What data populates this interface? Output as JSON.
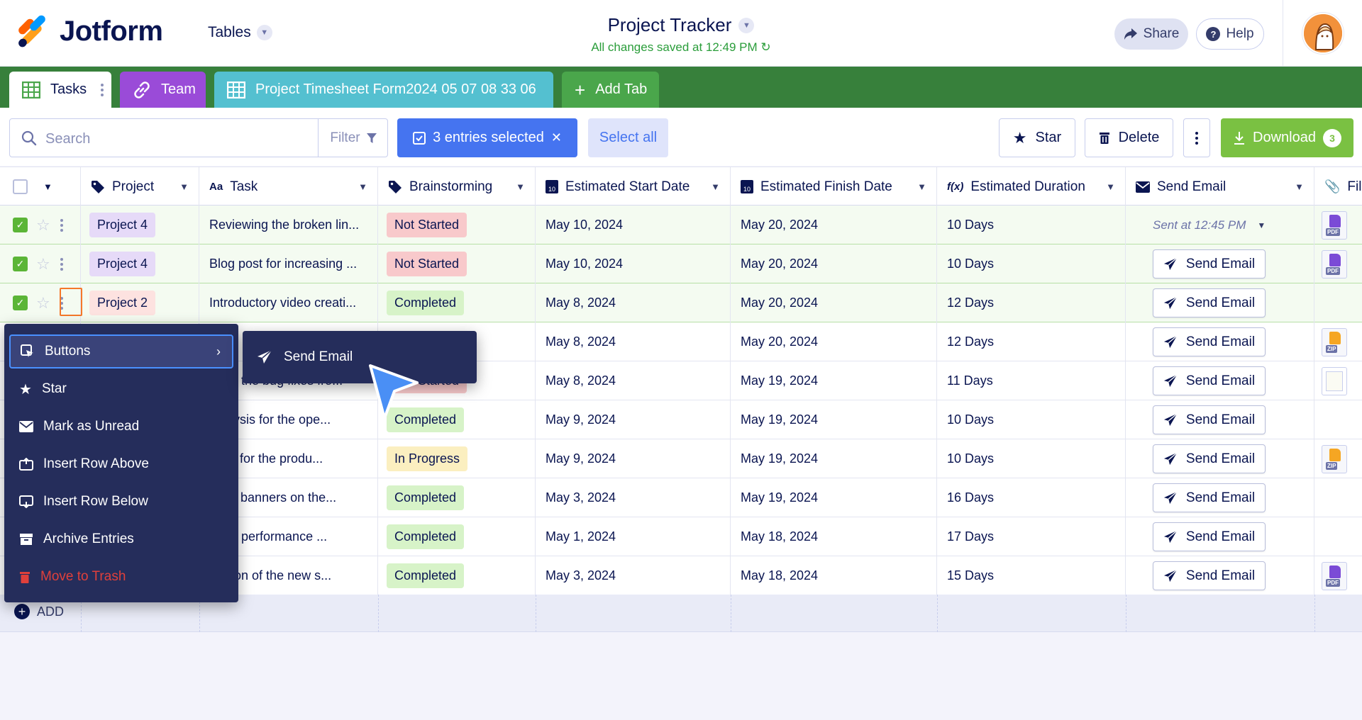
{
  "app": {
    "logo_text": "Jotform",
    "tables_label": "Tables"
  },
  "header": {
    "title": "Project Tracker",
    "saved_status": "All changes saved at 12:49 PM",
    "share_label": "Share",
    "help_label": "Help"
  },
  "tabs": [
    {
      "label": "Tasks"
    },
    {
      "label": "Team"
    },
    {
      "label": "Project Timesheet Form2024 05 07 08 33 06"
    },
    {
      "label": "Add Tab"
    }
  ],
  "toolbar": {
    "search_placeholder": "Search",
    "filter_label": "Filter",
    "selected_label": "3 entries selected",
    "select_all_label": "Select all",
    "star_label": "Star",
    "delete_label": "Delete",
    "download_label": "Download",
    "download_count": "3"
  },
  "columns": [
    "Project",
    "Task",
    "Brainstorming",
    "Estimated Start Date",
    "Estimated Finish Date",
    "Estimated Duration",
    "Send Email",
    "Fil"
  ],
  "column_icons": {
    "task_prefix": "Aa",
    "duration_prefix": "f(x)",
    "calendar_day": "10"
  },
  "rows": [
    {
      "selected": true,
      "project": "Project 4",
      "project_color": "#e6daf8",
      "task": "Reviewing the broken lin...",
      "status": "Not Started",
      "status_key": "Not",
      "start": "May 10, 2024",
      "finish": "May 20, 2024",
      "duration": "10 Days",
      "email": "sent",
      "sent_text": "Sent at 12:45 PM",
      "file": "PDF"
    },
    {
      "selected": true,
      "project": "Project 4",
      "project_color": "#e6daf8",
      "task": "Blog post for increasing ...",
      "status": "Not Started",
      "status_key": "Not",
      "start": "May 10, 2024",
      "finish": "May 20, 2024",
      "duration": "10 Days",
      "email": "button",
      "file": "PDF"
    },
    {
      "selected": true,
      "project": "Project 2",
      "project_color": "#fde2e0",
      "task": "Introductory video creati...",
      "status": "Completed",
      "status_key": "Completed",
      "start": "May 8, 2024",
      "finish": "May 20, 2024",
      "duration": "12 Days",
      "email": "button",
      "file": ""
    },
    {
      "selected": false,
      "project": "",
      "task": "",
      "status": "",
      "status_key": "",
      "start": "May 8, 2024",
      "finish": "May 20, 2024",
      "duration": "12 Days",
      "email": "button",
      "file": "ZIP"
    },
    {
      "selected": false,
      "project": "",
      "task": "aring the bug fixes fro...",
      "status": "Not Started",
      "status_key": "Not",
      "start": "May 8, 2024",
      "finish": "May 19, 2024",
      "duration": "11 Days",
      "email": "button",
      "file": "IMG"
    },
    {
      "selected": false,
      "project": "",
      "task": "analysis for the ope...",
      "status": "Completed",
      "status_key": "Completed",
      "start": "May 9, 2024",
      "finish": "May 19, 2024",
      "duration": "10 Days",
      "email": "button",
      "file": ""
    },
    {
      "selected": false,
      "project": "",
      "task": "tests for the produ...",
      "status": "In Progress",
      "status_key": "In",
      "start": "May 9, 2024",
      "finish": "May 19, 2024",
      "duration": "10 Days",
      "email": "button",
      "file": "ZIP"
    },
    {
      "selected": false,
      "project": "",
      "task": "ating banners on the...",
      "status": "Completed",
      "status_key": "Completed",
      "start": "May 3, 2024",
      "finish": "May 19, 2024",
      "duration": "16 Days",
      "email": "button",
      "file": ""
    },
    {
      "selected": false,
      "project": "",
      "task": "aring performance ...",
      "status": "Completed",
      "status_key": "Completed",
      "start": "May 1, 2024",
      "finish": "May 18, 2024",
      "duration": "17 Days",
      "email": "button",
      "file": ""
    },
    {
      "selected": false,
      "project": "",
      "task": "aration of the new s...",
      "status": "Completed",
      "status_key": "Completed",
      "start": "May 3, 2024",
      "finish": "May 18, 2024",
      "duration": "15 Days",
      "email": "button",
      "file": "PDF"
    }
  ],
  "send_email_label": "Send Email",
  "add_row_label": "ADD",
  "context_menu": {
    "items": [
      {
        "label": "Buttons",
        "icon": "cursor-box-icon"
      },
      {
        "label": "Star",
        "icon": "star-icon"
      },
      {
        "label": "Mark as Unread",
        "icon": "envelope-icon"
      },
      {
        "label": "Insert Row Above",
        "icon": "insert-above-icon"
      },
      {
        "label": "Insert Row Below",
        "icon": "insert-below-icon"
      },
      {
        "label": "Archive Entries",
        "icon": "archive-icon"
      },
      {
        "label": "Move to Trash",
        "icon": "trash-icon"
      }
    ],
    "submenu_label": "Send Email"
  },
  "colors": {
    "tabs_bar": "#37803b",
    "team_tab": "#9a4bd8",
    "timesheet_tab": "#54c0d0",
    "add_tab": "#4aa64b",
    "selected_button": "#4574f0",
    "download": "#7ac142",
    "menu_bg": "#252d5b",
    "trash": "#e0403b"
  }
}
